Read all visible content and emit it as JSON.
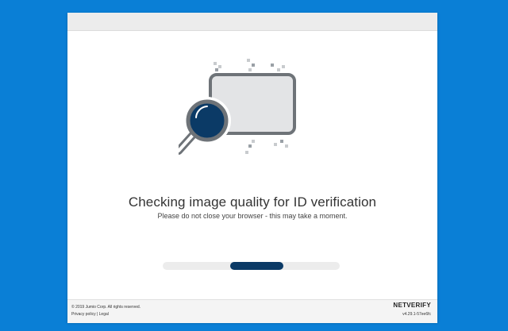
{
  "heading": "Checking image quality for ID verification",
  "subheading": "Please do not close your browser - this may take a moment.",
  "progress": {
    "fraction": 0.35
  },
  "footer": {
    "copyright": "© 2019 Jumio Corp. All rights reserved.",
    "links": "Privacy policy | Legal",
    "brand": "NETVERIFY",
    "version": "v4.29.1-57ee6fc"
  },
  "colors": {
    "background": "#0a7fd6",
    "accent": "#0b3a66",
    "icon_gray": "#6e7378"
  },
  "icons": [
    "id-card-icon",
    "magnifier-icon"
  ]
}
